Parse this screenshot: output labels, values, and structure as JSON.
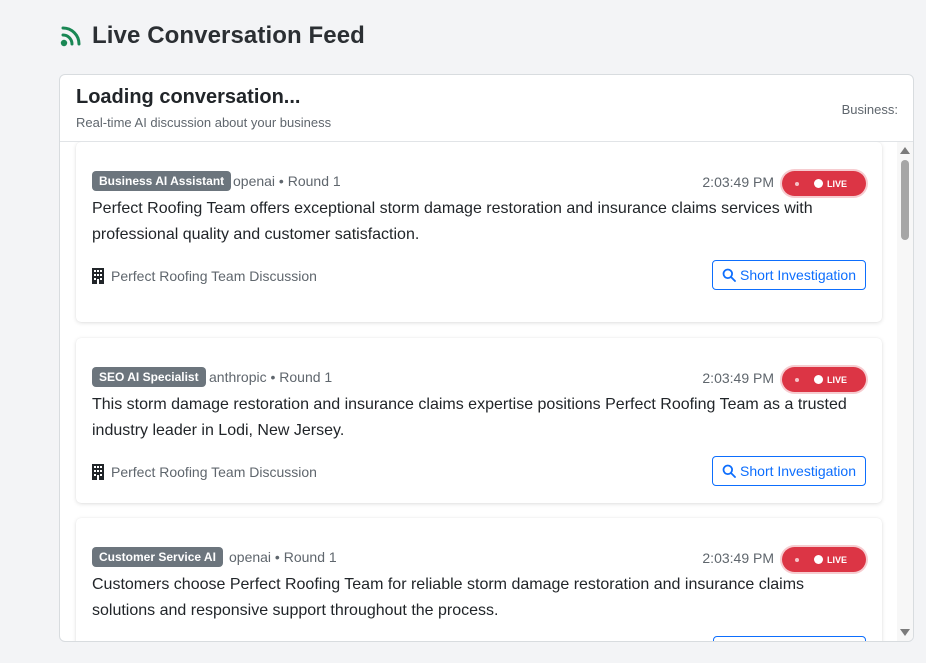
{
  "header": {
    "title": "Live Conversation Feed",
    "icon": "broadcast-icon"
  },
  "panel": {
    "title": "Loading conversation...",
    "subtitle": "Real-time AI discussion about your business",
    "business_label": "Business:"
  },
  "messages": [
    {
      "speaker": "Business AI Assistant",
      "meta": "openai • Round 1",
      "time": "2:03:49 PM",
      "live_label": "LIVE",
      "text": "Perfect Roofing Team offers exceptional storm damage restoration and insurance claims services with professional quality and customer satisfaction.",
      "footer": "Perfect Roofing Team Discussion",
      "action": "Short Investigation"
    },
    {
      "speaker": "SEO AI Specialist",
      "meta": "anthropic • Round 1",
      "time": "2:03:49 PM",
      "live_label": "LIVE",
      "text": "This storm damage restoration and insurance claims expertise positions Perfect Roofing Team as a trusted industry leader in Lodi, New Jersey.",
      "footer": "Perfect Roofing Team Discussion",
      "action": "Short Investigation"
    },
    {
      "speaker": "Customer Service AI",
      "meta": "openai • Round 1",
      "time": "2:03:49 PM",
      "live_label": "LIVE",
      "text": "Customers choose Perfect Roofing Team for reliable storm damage restoration and insurance claims solutions and responsive support throughout the process.",
      "footer": "",
      "action": ""
    }
  ],
  "colors": {
    "live": "#dc3545",
    "badge": "#6c757d",
    "primary": "#0d6efd",
    "header_icon": "#198754"
  }
}
